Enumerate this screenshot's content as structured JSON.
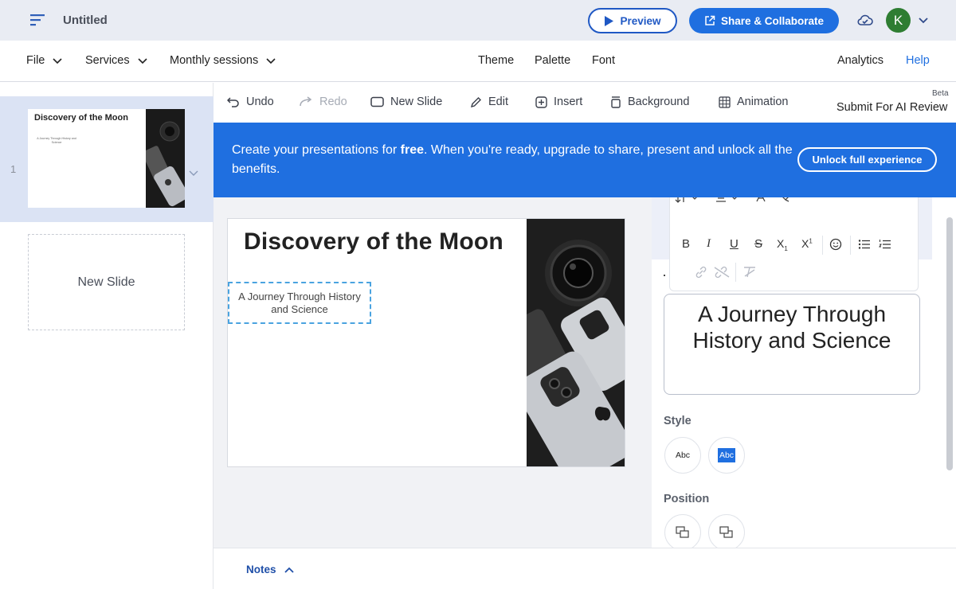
{
  "topbar": {
    "doc_title": "Untitled",
    "preview_label": "Preview",
    "share_label": "Share & Collaborate",
    "avatar_initial": "K"
  },
  "menubar": {
    "file": "File",
    "services": "Services",
    "monthly_sessions": "Monthly sessions",
    "theme": "Theme",
    "palette": "Palette",
    "font": "Font",
    "analytics": "Analytics",
    "help": "Help"
  },
  "toolbar": {
    "undo": "Undo",
    "redo": "Redo",
    "new_slide": "New Slide",
    "edit": "Edit",
    "insert": "Insert",
    "background": "Background",
    "animation": "Animation",
    "beta": "Beta",
    "ai_review": "Submit For AI Review"
  },
  "banner": {
    "text_pre": "Create your presentations for ",
    "text_bold": "free",
    "text_post": ". When you're ready, upgrade to share, present and unlock all the benefits.",
    "unlock_label": "Unlock full experience"
  },
  "slides_panel": {
    "slides": [
      {
        "number": "1",
        "title": "Discovery of the Moon",
        "subtitle": "A Journey Through History and Science"
      }
    ],
    "new_slide_label": "New Slide"
  },
  "slide": {
    "title": "Discovery of the Moon",
    "subtitle": "A Journey Through History and Science"
  },
  "format_panel": {
    "text_value": "A Journey Through History and Science",
    "style_label": "Style",
    "style_options": [
      "Abc",
      "Abc"
    ],
    "position_label": "Position"
  },
  "notes": {
    "label": "Notes"
  },
  "colors": {
    "accent": "#1f6fe0",
    "banner": "#1f6fe0",
    "topbar_bg": "#e9ecf3",
    "selected_thumb": "#dbe3f4"
  }
}
